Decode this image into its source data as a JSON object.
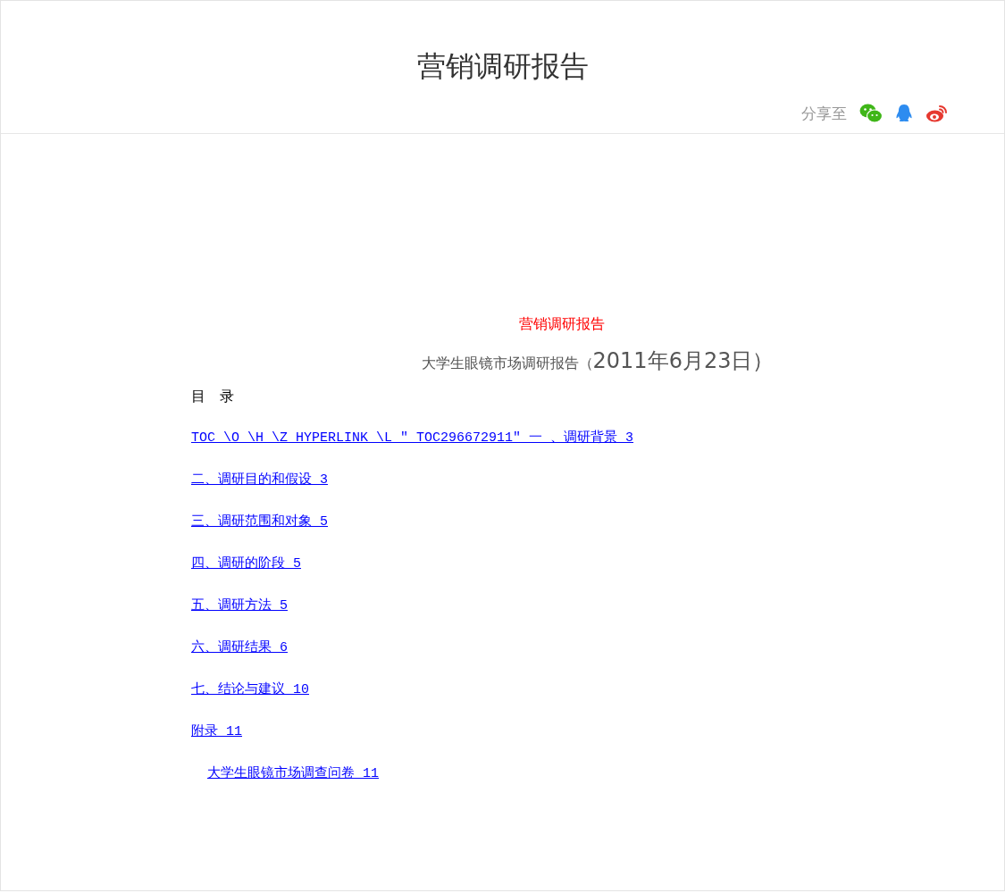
{
  "header": {
    "title": "营销调研报告",
    "share_label": "分享至"
  },
  "document": {
    "title": "营销调研报告",
    "subtitle": "大学生眼镜市场调研报告（",
    "date": "2011年6月23日）",
    "toc_heading": "目　录",
    "toc": [
      {
        "text": "TOC \\O \\H \\Z HYPERLINK \\L \"_TOC296672911\" 一 、调研背景 3"
      },
      {
        "text": "二、调研目的和假设 3"
      },
      {
        "text": "三、调研范围和对象 5"
      },
      {
        "text": "四、调研的阶段 5"
      },
      {
        "text": "五、调研方法 5"
      },
      {
        "text": "六、调研结果 6"
      },
      {
        "text": "七、结论与建议 10"
      },
      {
        "text": "附录 11",
        "children": [
          {
            "text": "大学生眼镜市场调查问卷 11"
          }
        ]
      }
    ]
  }
}
